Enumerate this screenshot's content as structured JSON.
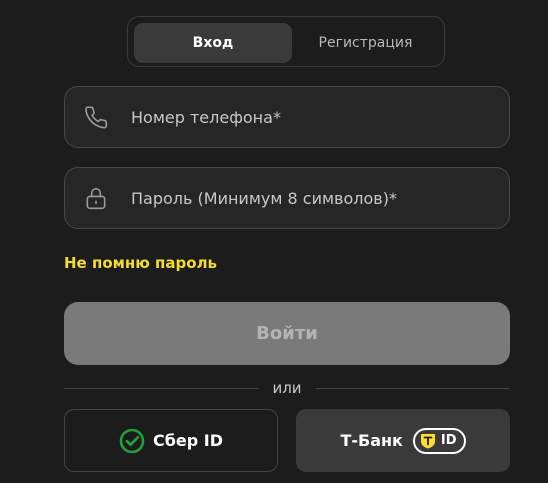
{
  "tabs": {
    "login_label": "Вход",
    "register_label": "Регистрация"
  },
  "phone_field": {
    "icon": "phone-icon",
    "placeholder": "Номер телефона*",
    "value": ""
  },
  "password_field": {
    "icon": "lock-icon",
    "placeholder": "Пароль (Минимум 8 символов)*",
    "value": ""
  },
  "forgot_link": "Не помню пароль",
  "submit_label": "Войти",
  "divider_text": "или",
  "social": {
    "sber": {
      "icon": "sber-logo-icon",
      "label": "Сбер ID"
    },
    "tbank": {
      "label": "Т-Банк",
      "badge_icon": "tbank-shield-icon",
      "badge_text": "ID"
    }
  },
  "colors": {
    "background": "#1c1c1c",
    "accent_yellow": "#f2dc2d",
    "sber_green": "#21a038",
    "tbank_yellow": "#ffdd2d"
  }
}
